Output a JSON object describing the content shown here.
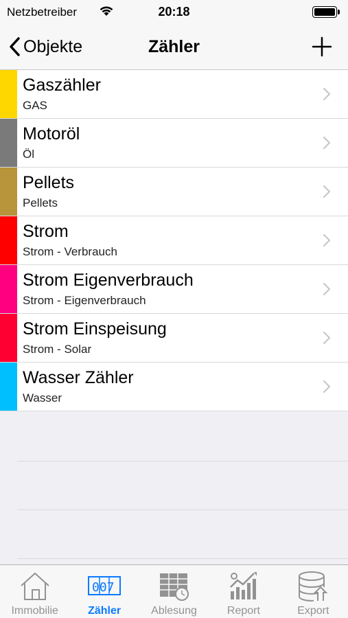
{
  "status": {
    "carrier": "Netzbetreiber",
    "time": "20:18"
  },
  "nav": {
    "back_label": "Objekte",
    "title": "Zähler"
  },
  "meters": [
    {
      "title": "Gaszähler",
      "subtitle": "GAS",
      "color": "#ffd700"
    },
    {
      "title": "Motoröl",
      "subtitle": "Öl",
      "color": "#7a7a7a"
    },
    {
      "title": "Pellets",
      "subtitle": "Pellets",
      "color": "#b8943a"
    },
    {
      "title": "Strom",
      "subtitle": "Strom - Verbrauch",
      "color": "#ff0000"
    },
    {
      "title": "Strom Eigenverbrauch",
      "subtitle": "Strom - Eigenverbrauch",
      "color": "#ff0080"
    },
    {
      "title": "Strom Einspeisung",
      "subtitle": "Strom - Solar",
      "color": "#ff0033"
    },
    {
      "title": "Wasser Zähler",
      "subtitle": "Wasser",
      "color": "#00bfff"
    }
  ],
  "tabs": [
    {
      "label": "Immobilie",
      "icon": "house-icon",
      "active": false
    },
    {
      "label": "Zähler",
      "icon": "counter-icon",
      "active": true
    },
    {
      "label": "Ablesung",
      "icon": "table-clock-icon",
      "active": false
    },
    {
      "label": "Report",
      "icon": "chart-icon",
      "active": false
    },
    {
      "label": "Export",
      "icon": "database-export-icon",
      "active": false
    }
  ],
  "colors": {
    "accent": "#0a7aff",
    "inactive": "#929292"
  }
}
